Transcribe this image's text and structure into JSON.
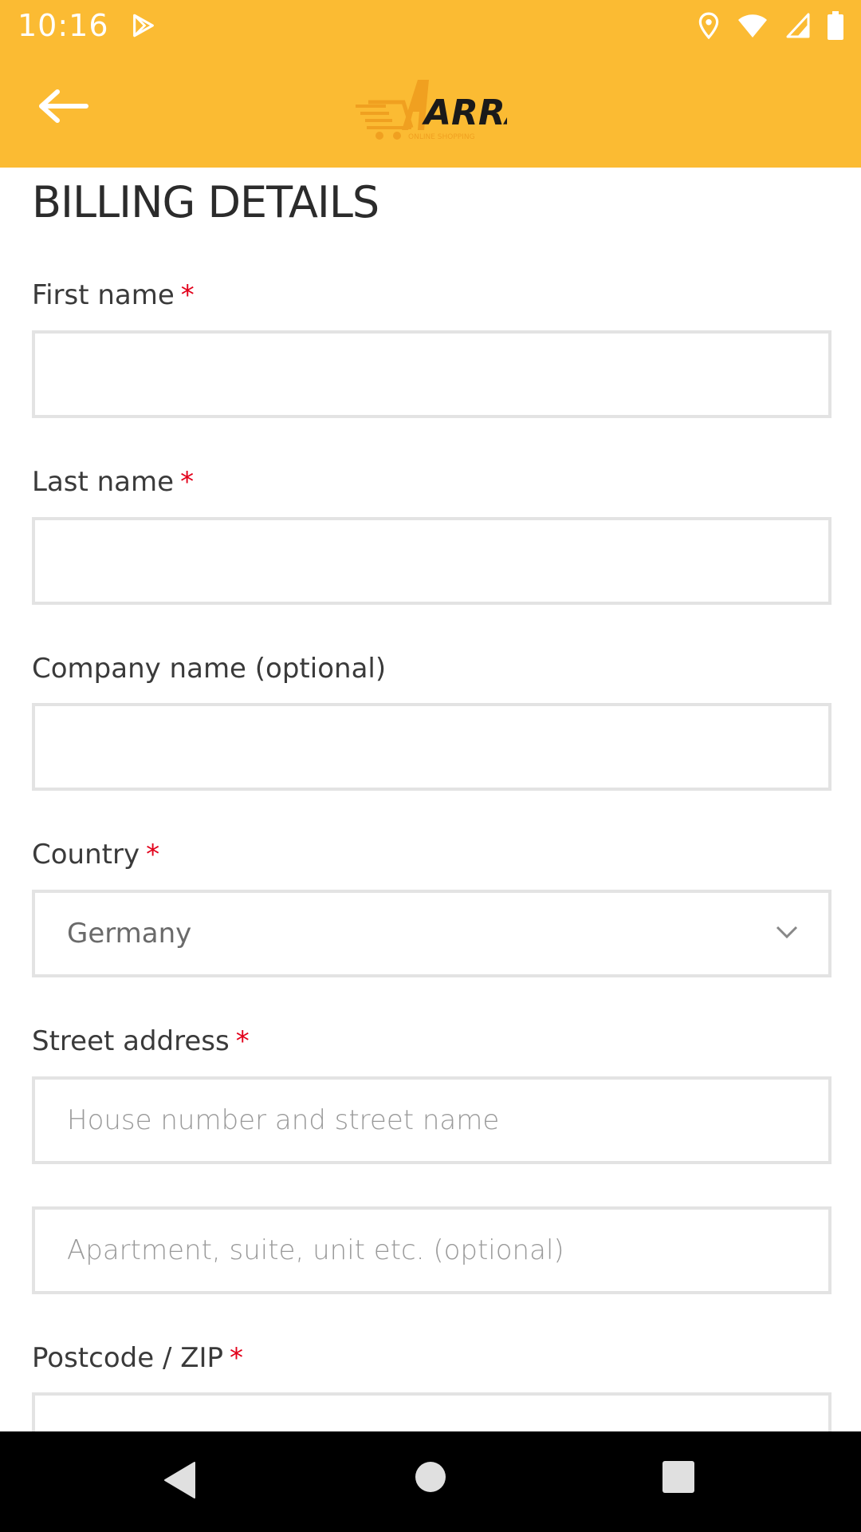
{
  "status_bar": {
    "time": "10:16",
    "icons": [
      "play-store-icon",
      "location-icon",
      "wifi-icon",
      "signal-icon",
      "battery-icon"
    ]
  },
  "app_bar": {
    "back_icon": "arrow-left-icon",
    "logo_text": "ARRAM",
    "logo_subtitle": "ONLINE SHOPPING"
  },
  "form": {
    "title": "BILLING DETAILS",
    "required_mark": "*",
    "fields": {
      "first_name": {
        "label": "First name",
        "value": "",
        "required": true
      },
      "last_name": {
        "label": "Last name",
        "value": "",
        "required": true
      },
      "company": {
        "label": "Company name (optional)",
        "value": "",
        "required": false
      },
      "country": {
        "label": "Country",
        "value": "Germany",
        "required": true
      },
      "street": {
        "label": "Street address",
        "placeholder_1": "House number and street name",
        "placeholder_2": "Apartment, suite, unit etc. (optional)",
        "required": true
      },
      "postcode": {
        "label": "Postcode / ZIP",
        "value": "",
        "required": true
      }
    }
  },
  "colors": {
    "accent": "#fbbb33",
    "required": "#e2001a",
    "border": "#e3e3e3"
  },
  "nav_bar": {
    "icons": [
      "back-triangle-icon",
      "home-circle-icon",
      "recents-square-icon"
    ]
  }
}
